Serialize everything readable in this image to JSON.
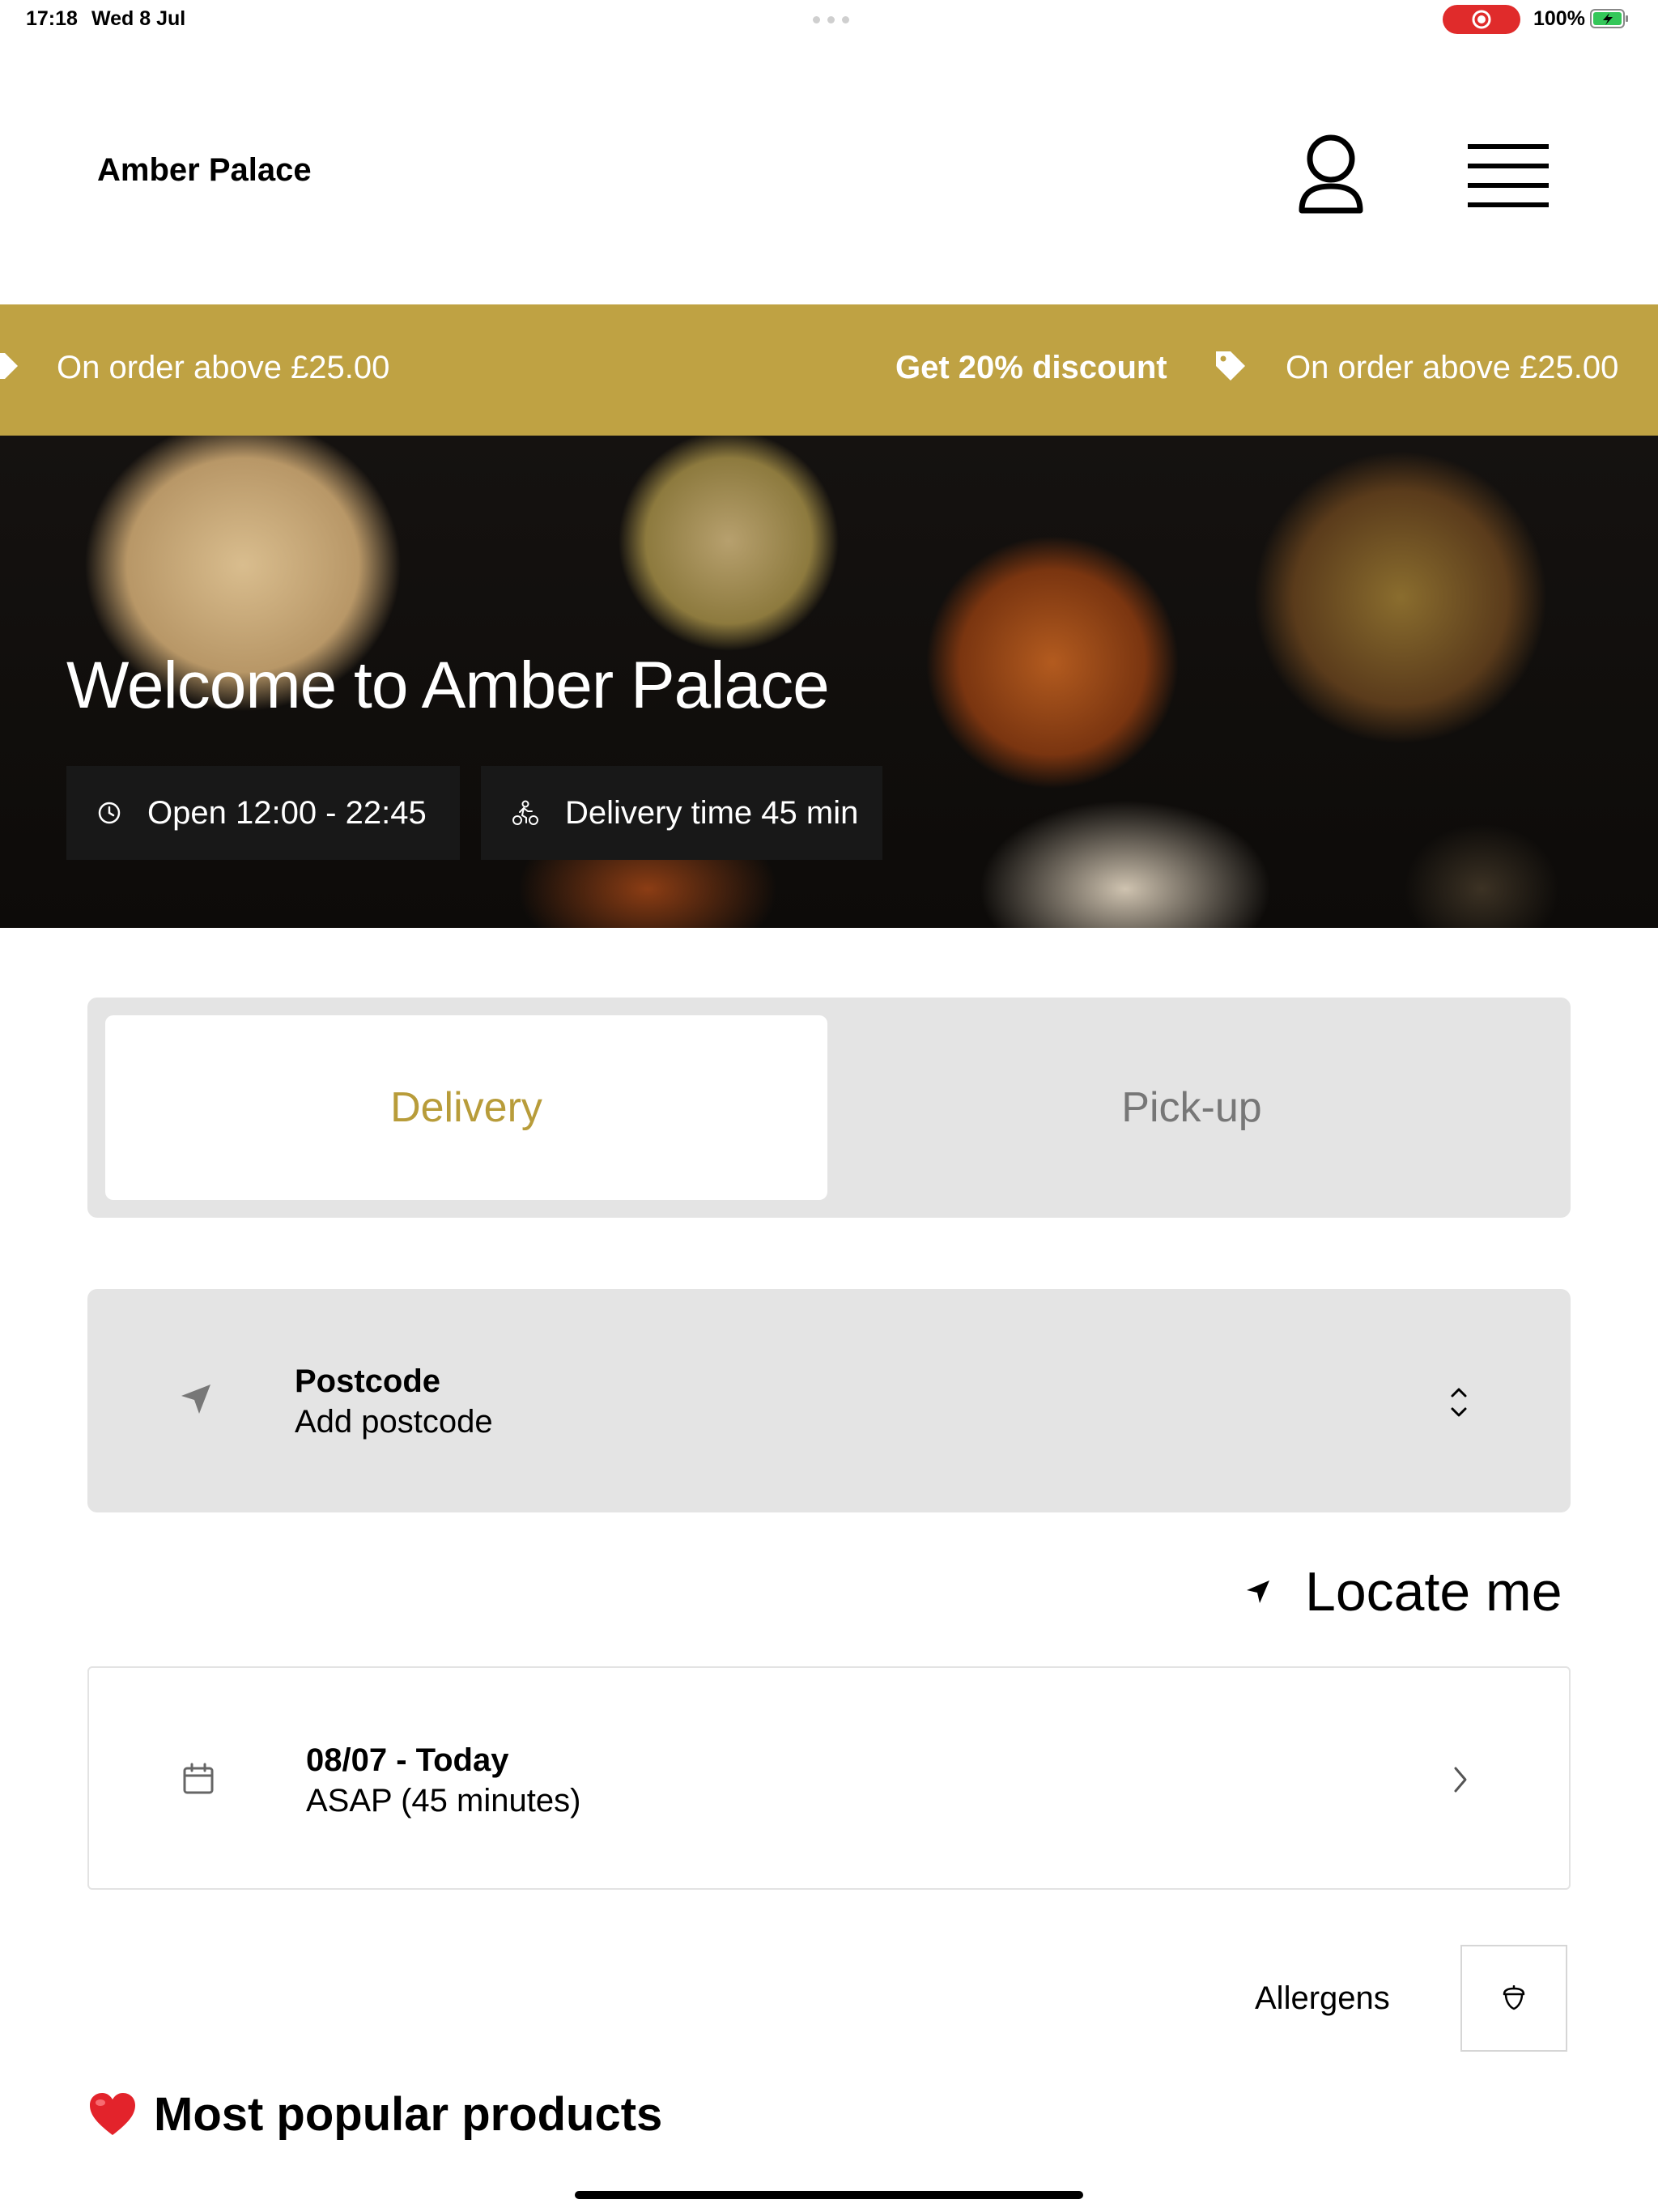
{
  "status_bar": {
    "time": "17:18",
    "date": "Wed 8 Jul",
    "battery": "100%"
  },
  "header": {
    "brand": "Amber Palace",
    "account_icon": "person-icon",
    "menu_icon": "hamburger-menu-icon"
  },
  "promo": {
    "left_text": "On order above £25.00",
    "discount_text": "Get 20% discount",
    "right_text": "On order above £25.00",
    "icon": "tag-icon"
  },
  "hero": {
    "title": "Welcome to Amber Palace",
    "open_hours": "Open 12:00 - 22:45",
    "delivery_time": "Delivery time 45 min"
  },
  "order_type": {
    "options": [
      "Delivery",
      "Pick-up"
    ],
    "selected": "Delivery"
  },
  "postcode": {
    "label": "Postcode",
    "value": "Add postcode"
  },
  "locate": {
    "label": "Locate me"
  },
  "schedule": {
    "date": "08/07 - Today",
    "time": "ASAP (45 minutes)"
  },
  "allergens": {
    "label": "Allergens"
  },
  "popular": {
    "title": "Most popular products"
  },
  "colors": {
    "accent": "#bfa243",
    "panel": "#e4e4e4",
    "chip": "#181818",
    "record": "#e02b2b"
  }
}
